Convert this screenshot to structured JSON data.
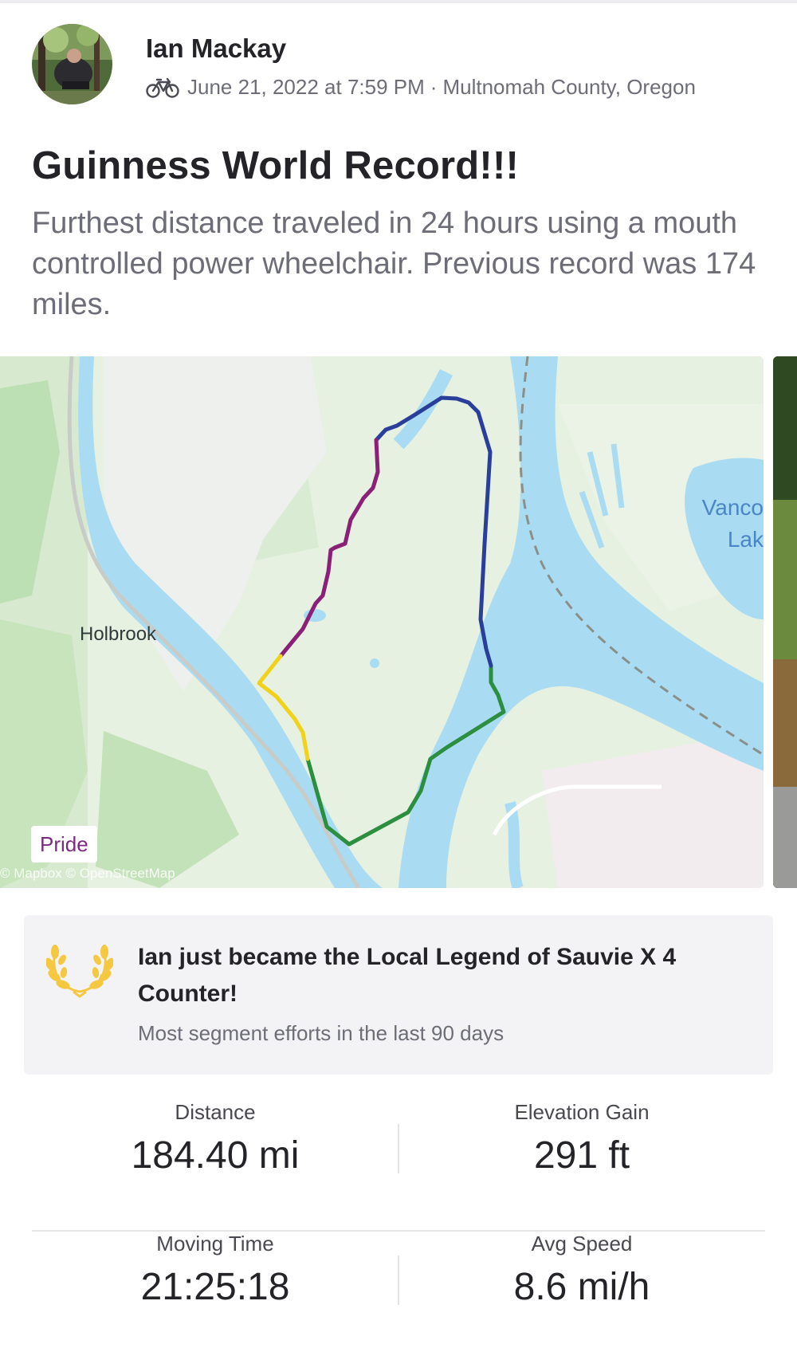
{
  "post": {
    "author": "Ian Mackay",
    "activity_icon": "bike-icon",
    "date": "June 21, 2022 at 7:59 PM",
    "separator": "·",
    "location": "Multnomah County, Oregon",
    "title": "Guinness World Record!!!",
    "description": "Furthest distance traveled in 24 hours using a mouth controlled power wheelchair. Previous record was 174 miles."
  },
  "map": {
    "place_holbrook": "Holbrook",
    "place_vanco_1": "Vanco",
    "place_vanco_2": "Lak",
    "badge": "Pride",
    "attribution": "© Mapbox © OpenStreetMap",
    "route_colors": [
      "#2a3f9a",
      "#8a2077",
      "#f1d21b",
      "#2c8e3f"
    ],
    "water_color": "#a9dcf2",
    "land_color": "#e7f2e2"
  },
  "legend": {
    "icon": "laurel-wreath-icon",
    "title": "Ian just became the Local Legend of Sauvie X 4 Counter!",
    "subtitle": "Most segment efforts in the last 90 days",
    "icon_color": "#f5c842"
  },
  "stats": [
    {
      "label": "Distance",
      "value": "184.40 mi"
    },
    {
      "label": "Elevation Gain",
      "value": "291 ft"
    },
    {
      "label": "Moving Time",
      "value": "21:25:18"
    },
    {
      "label": "Avg Speed",
      "value": "8.6 mi/h"
    }
  ]
}
